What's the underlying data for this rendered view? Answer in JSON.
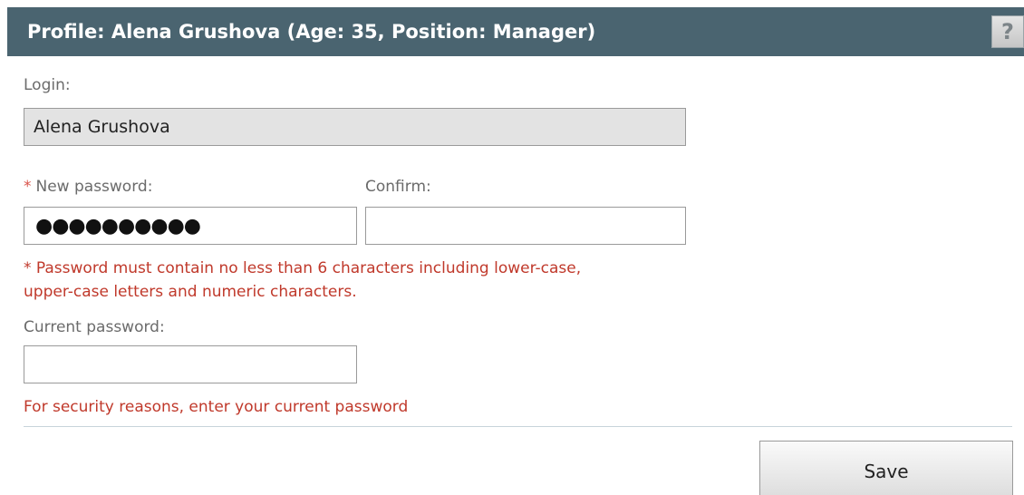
{
  "header": {
    "title": "Profile: Alena Grushova (Age: 35, Position: Manager)",
    "help_label": "?"
  },
  "form": {
    "login_label": "Login:",
    "login_value": "Alena Grushova",
    "required_marker": "*",
    "new_password_label": "New password:",
    "new_password_masked": "●●●●●●●●●●",
    "confirm_label": "Confirm:",
    "confirm_value": "",
    "password_hint_line1": "* Password must contain no less than 6 characters including lower-case,",
    "password_hint_line2": "upper-case letters and numeric characters.",
    "current_password_label": "Current password:",
    "current_password_value": "",
    "security_note": "For security reasons, enter your current password"
  },
  "actions": {
    "save_label": "Save"
  },
  "colors": {
    "header_bg": "#4a6470",
    "error_text": "#c0392b",
    "required_marker": "#d9534a"
  }
}
